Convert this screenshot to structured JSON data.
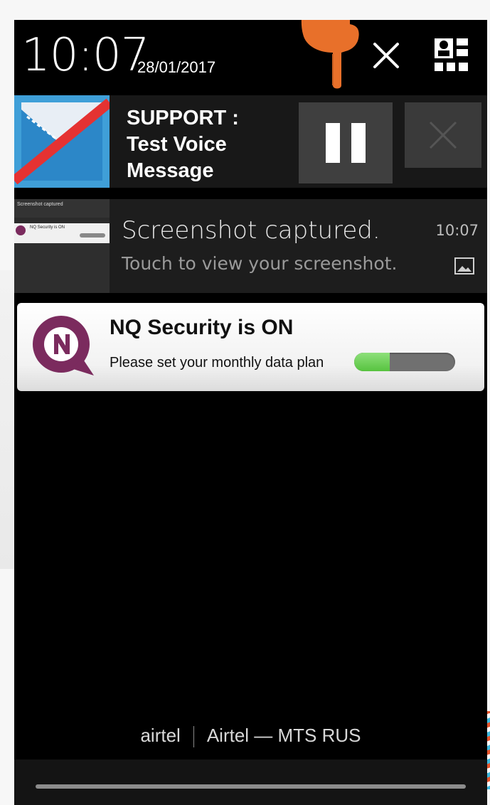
{
  "status": {
    "time": "10:07",
    "date": "28/01/2017",
    "clear_icon": "close-icon",
    "settings_icon": "quick-settings-icon"
  },
  "notifications": [
    {
      "app_icon": "voice-message-icon",
      "title": "SUPPORT :\nTest Voice\nMessage",
      "actions": [
        "pause-icon",
        "stop-close-icon"
      ]
    },
    {
      "title": "Screenshot captured.",
      "subtitle": "Touch to view your screenshot.",
      "time": "10:07",
      "thumbnail_lines": [
        "Screenshot captured",
        "NQ Security is ON"
      ],
      "indicator_icon": "image-icon"
    },
    {
      "title": "NQ Security is ON",
      "text": "Please set your monthly data plan",
      "progress": 0.35,
      "app_icon": "nq-logo-icon"
    }
  ],
  "carrier": {
    "left": "airtel",
    "right": "Airtel — MTS RUS"
  },
  "colors": {
    "hand": "#e8702a",
    "nq_purple": "#7b2b5e",
    "progress_green": "#6fd456",
    "voice_blue": "#4aa6dc"
  }
}
